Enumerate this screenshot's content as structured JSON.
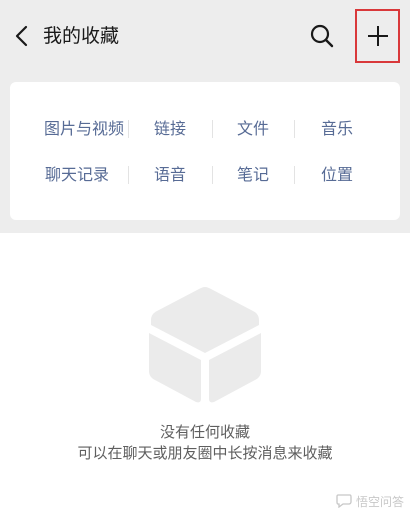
{
  "header": {
    "title": "我的收藏",
    "back_icon": "chevron-left-icon",
    "search_icon": "search-icon",
    "add_icon": "plus-icon",
    "highlight_color": "#d9383a"
  },
  "categories": {
    "row1": [
      "图片与视频",
      "链接",
      "文件",
      "音乐"
    ],
    "row2": [
      "聊天记录",
      "语音",
      "笔记",
      "位置"
    ],
    "link_color": "#576b95"
  },
  "empty_state": {
    "icon": "cube-icon",
    "title": "没有任何收藏",
    "hint": "可以在聊天或朋友圈中长按消息来收藏"
  },
  "watermark": {
    "text": "悟空问答"
  }
}
